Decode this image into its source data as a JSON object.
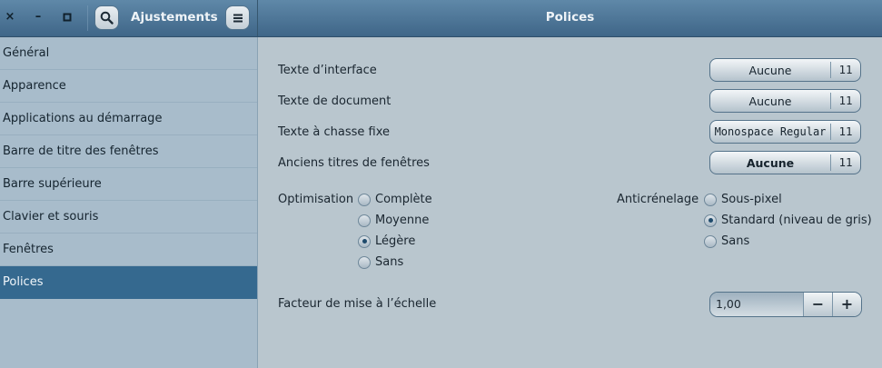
{
  "titlebar": {
    "app_title": "Ajustements",
    "page_title": "Polices",
    "close_glyph": "×",
    "minimize_glyph": "–",
    "maximize_glyph": "▫",
    "search_icon": "search-icon",
    "menu_icon": "hamburger-menu-icon"
  },
  "sidebar": {
    "items": [
      {
        "label": "Général"
      },
      {
        "label": "Apparence"
      },
      {
        "label": "Applications au démarrage"
      },
      {
        "label": "Barre de titre des fenêtres"
      },
      {
        "label": "Barre supérieure"
      },
      {
        "label": "Clavier et souris"
      },
      {
        "label": "Fenêtres"
      },
      {
        "label": "Polices"
      }
    ],
    "active_index": 7
  },
  "fonts": {
    "interface": {
      "label": "Texte d’interface",
      "font": "Aucune",
      "size": "11"
    },
    "document": {
      "label": "Texte de document",
      "font": "Aucune",
      "size": "11"
    },
    "monospace": {
      "label": "Texte à chasse fixe",
      "font": "Monospace Regular",
      "size": "11"
    },
    "legacy_titles": {
      "label": "Anciens titres de fenêtres",
      "font": "Aucune",
      "size": "11"
    }
  },
  "hinting": {
    "label": "Optimisation",
    "options": [
      "Complète",
      "Moyenne",
      "Légère",
      "Sans"
    ],
    "selected": "Légère"
  },
  "antialiasing": {
    "label": "Anticrénelage",
    "options": [
      "Sous-pixel",
      "Standard (niveau de gris)",
      "Sans"
    ],
    "selected": "Standard (niveau de gris)"
  },
  "scaling": {
    "label": "Facteur de mise à l’échelle",
    "value": "1,00",
    "minus": "−",
    "plus": "+"
  },
  "colors": {
    "titlebar": "#4a7395",
    "sidebar": "#a8bccb",
    "active_item": "#35698f",
    "content": "#b9c6ce"
  }
}
